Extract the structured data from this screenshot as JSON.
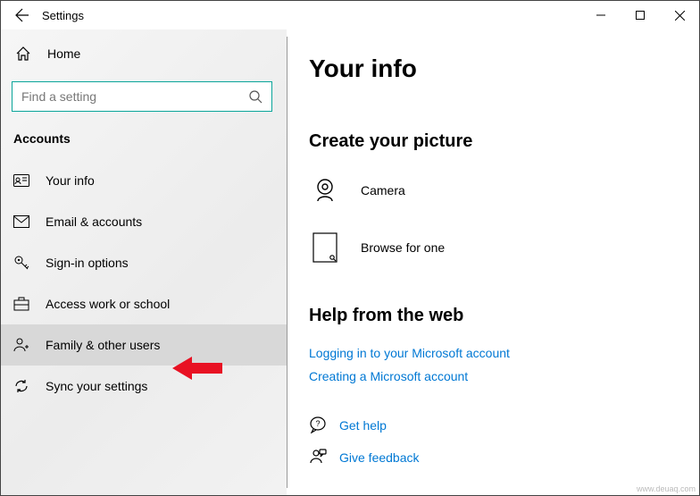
{
  "window": {
    "title": "Settings"
  },
  "sidebar": {
    "home": "Home",
    "search_placeholder": "Find a setting",
    "category": "Accounts",
    "items": [
      {
        "label": "Your info"
      },
      {
        "label": "Email & accounts"
      },
      {
        "label": "Sign-in options"
      },
      {
        "label": "Access work or school"
      },
      {
        "label": "Family & other users"
      },
      {
        "label": "Sync your settings"
      }
    ]
  },
  "main": {
    "heading": "Your info",
    "picture": {
      "title": "Create your picture",
      "camera": "Camera",
      "browse": "Browse for one"
    },
    "help": {
      "title": "Help from the web",
      "links": [
        "Logging in to your Microsoft account",
        "Creating a Microsoft account"
      ]
    },
    "get_help": "Get help",
    "feedback": "Give feedback"
  },
  "watermark": "www.deuaq.com"
}
